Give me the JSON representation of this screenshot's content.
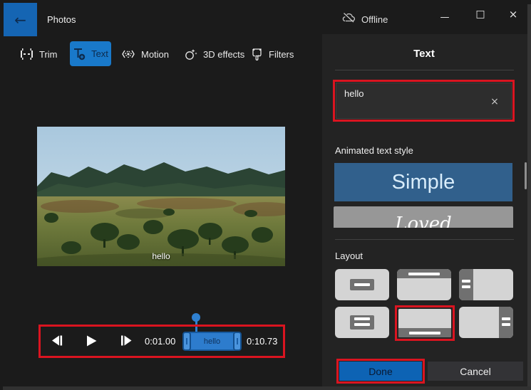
{
  "titlebar": {
    "app_title": "Photos",
    "offline_label": "Offline",
    "back_glyph": "←",
    "minimize_glyph": "—",
    "maximize_glyph": "□",
    "close_glyph": "×"
  },
  "tabs": [
    {
      "label": "Trim",
      "icon": "trim-icon",
      "selected": false
    },
    {
      "label": "Text",
      "icon": "add-text-icon",
      "selected": true
    },
    {
      "label": "Motion",
      "icon": "motion-icon",
      "selected": false
    },
    {
      "label": "3D effects",
      "icon": "3d-effects-icon",
      "selected": false
    },
    {
      "label": "Filters",
      "icon": "filters-icon",
      "selected": false
    }
  ],
  "preview": {
    "caption": "hello"
  },
  "playback": {
    "current_time": "0:01.00",
    "total_time": "0:10.73",
    "clip_label": "hello"
  },
  "panel": {
    "title": "Text",
    "text_input": {
      "value": "hello",
      "clear_glyph": "×"
    },
    "styles_section": {
      "label": "Animated text style",
      "options": [
        {
          "name": "Simple",
          "selected": true
        },
        {
          "name": "Loved",
          "selected": false
        }
      ]
    },
    "layout_section": {
      "label": "Layout",
      "option_count": 6,
      "selected_index": 4,
      "option_names": [
        "center-box",
        "top-banner",
        "left-sidebar",
        "center-two-lines",
        "bottom-banner",
        "right-sidebar"
      ]
    },
    "done_label": "Done",
    "cancel_label": "Cancel"
  },
  "colors": {
    "accent_tab_blue": "#1979ca",
    "selected_style_blue": "#31608c",
    "done_blue": "#0d63b4",
    "timeline_blue": "#2d7ccd",
    "annotation_red": "#da1420",
    "panel_bg": "#232323",
    "main_bg": "#1b1b1b"
  }
}
